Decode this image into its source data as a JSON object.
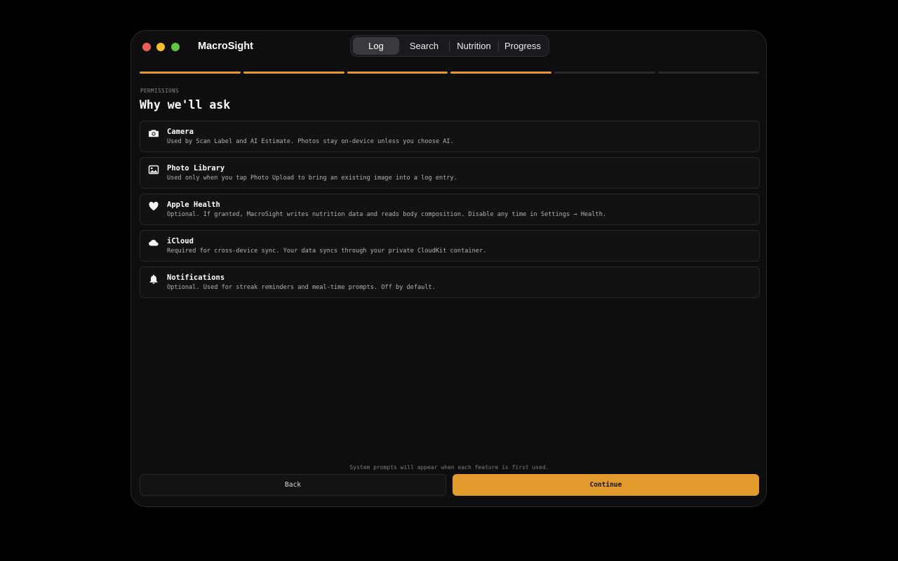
{
  "app": {
    "title": "MacroSight"
  },
  "nav": {
    "tabs": [
      {
        "label": "Log",
        "active": true
      },
      {
        "label": "Search",
        "active": false
      },
      {
        "label": "Nutrition",
        "active": false
      },
      {
        "label": "Progress",
        "active": false
      }
    ]
  },
  "onboarding": {
    "steps_total": 6,
    "steps_completed": 4
  },
  "section": {
    "eyebrow": "PERMISSIONS",
    "heading": "Why we'll ask"
  },
  "permissions": [
    {
      "icon": "camera-icon",
      "title": "Camera",
      "description": "Used by Scan Label and AI Estimate. Photos stay on-device unless you choose AI."
    },
    {
      "icon": "photo-icon",
      "title": "Photo Library",
      "description": "Used only when you tap Photo Upload to bring an existing image into a log entry."
    },
    {
      "icon": "heart-icon",
      "title": "Apple Health",
      "description": "Optional. If granted, MacroSight writes nutrition data and reads body composition. Disable any time in Settings → Health."
    },
    {
      "icon": "cloud-icon",
      "title": "iCloud",
      "description": "Required for cross-device sync. Your data syncs through your private CloudKit container."
    },
    {
      "icon": "bell-icon",
      "title": "Notifications",
      "description": "Optional. Used for streak reminders and meal-time prompts. Off by default."
    }
  ],
  "footer": {
    "note": "System prompts will appear when each feature is first used.",
    "back_label": "Back",
    "continue_label": "Continue"
  },
  "colors": {
    "accent": "#e19a2b",
    "window_bg": "#0e0e0f",
    "card_bg": "#121213"
  }
}
